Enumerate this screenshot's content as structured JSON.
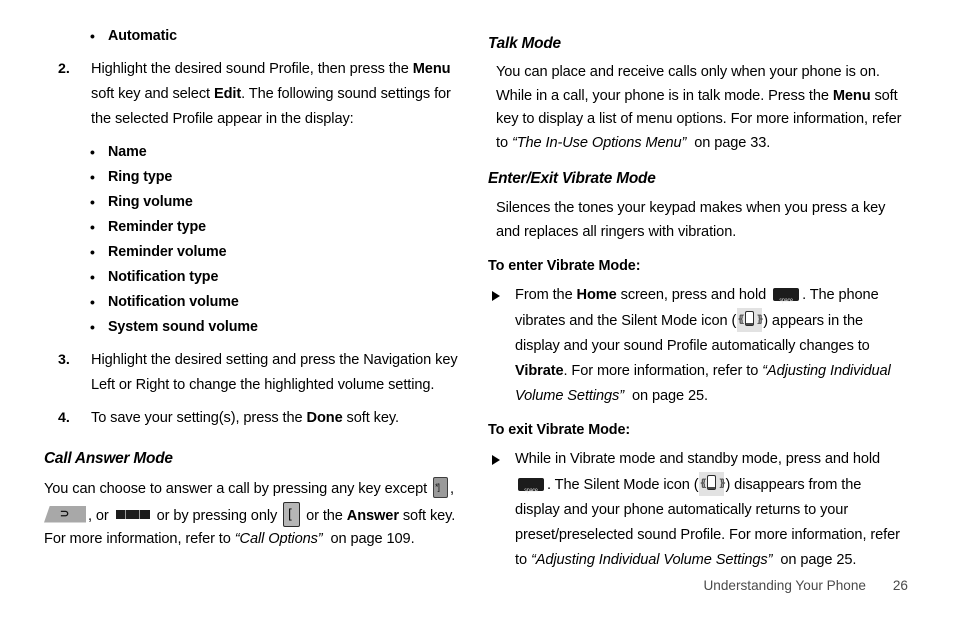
{
  "left_column": {
    "bullet_automatic": "Automatic",
    "step2": {
      "number": "2.",
      "text_a": "Highlight the desired sound Profile, then press the ",
      "bold_menu": "Menu",
      "text_b": " soft key and select ",
      "bold_edit": "Edit",
      "text_c": ". The following sound settings for the selected Profile appear in the display:"
    },
    "settings_bullets": [
      "Name",
      "Ring type",
      "Ring volume",
      "Reminder type",
      "Reminder volume",
      "Notification type",
      "Notification volume",
      "System sound volume"
    ],
    "step3": {
      "number": "3.",
      "text": "Highlight the desired setting and press the Navigation key Left or Right to change the highlighted volume setting."
    },
    "step4": {
      "number": "4.",
      "text_a": "To save your setting(s), press the ",
      "bold_done": "Done",
      "text_b": " soft key."
    },
    "call_answer_mode": {
      "heading": "Call Answer Mode",
      "text_a": "You can choose to answer a call by pressing any key except ",
      "icon_star": "star-key-icon",
      "text_b": ", ",
      "icon_end": "end-key-icon",
      "text_c": ", or ",
      "icon_bar": "navigation-bar-key-icon",
      "text_d": " or by pressing only ",
      "icon_send": "send-key-icon",
      "text_e": " or the ",
      "bold_answer": "Answer",
      "text_f": " soft key. For more information, refer to ",
      "ref_call_options": "“Call Options”",
      "text_g": " on page 109."
    }
  },
  "right_column": {
    "talk_mode": {
      "heading": "Talk Mode",
      "text_a": "You can place and receive calls only when your phone is on. While in a call, your phone is in talk mode. Press the ",
      "bold_menu": "Menu",
      "text_b": " soft key to display a list of menu options. For more information, refer to ",
      "ref_in_use": "“The In-Use Options Menu”",
      "text_c": " on page 33."
    },
    "vibrate_mode": {
      "heading": "Enter/Exit Vibrate Mode",
      "intro": "Silences the tones your keypad makes when you press a key and replaces all ringers with vibration.",
      "enter_subhead": "To enter Vibrate Mode:",
      "enter_body": {
        "text_a": "From the ",
        "bold_home": "Home",
        "text_b": " screen, press and hold ",
        "icon_space": "space-key-icon",
        "text_c": ". The phone vibrates and the Silent Mode icon (",
        "icon_silent": "silent-mode-icon",
        "text_d": ") appears in the display and your sound Profile automatically changes to ",
        "bold_vibrate": "Vibrate",
        "text_e": ". For more information, refer to ",
        "ref_adjusting": "“Adjusting Individual Volume Settings”",
        "text_f": " on page 25."
      },
      "exit_subhead": "To exit Vibrate Mode:",
      "exit_body": {
        "text_a": "While in Vibrate mode and standby mode, press and hold ",
        "icon_space": "space-key-icon",
        "text_b": ". The Silent Mode icon (",
        "icon_silent": "silent-mode-icon",
        "text_c": ") disappears from the display and your phone automatically returns to your preset/preselected sound Profile. For more information, refer to ",
        "ref_adjusting": "“Adjusting Individual Volume Settings”",
        "text_d": " on page 25."
      }
    }
  },
  "footer": {
    "chapter": "Understanding Your Phone",
    "page_number": "26"
  }
}
